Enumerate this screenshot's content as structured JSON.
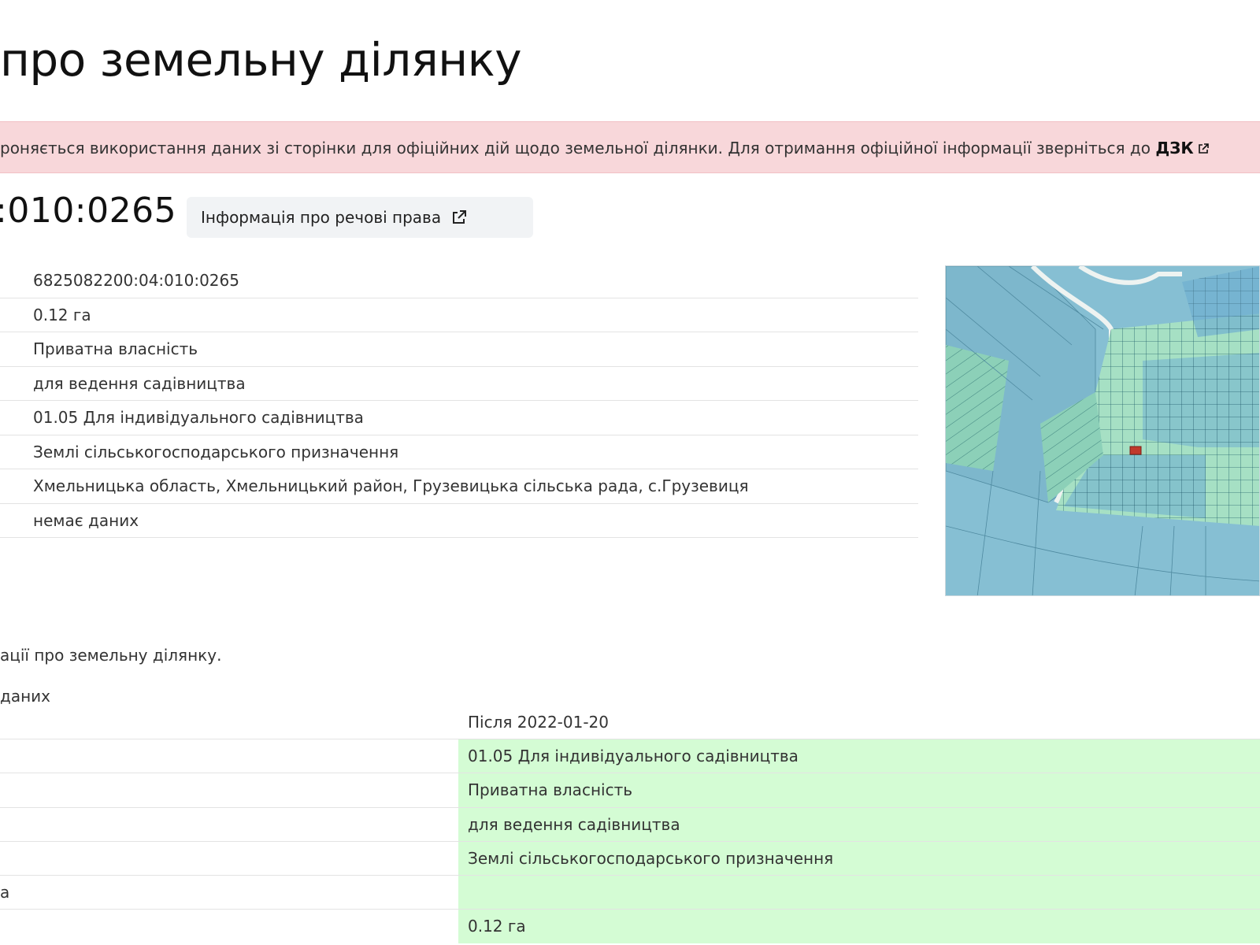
{
  "header": {
    "title": "про земельну ділянку"
  },
  "warning": {
    "text": "роняється використання даних зі сторінки для офіційних дій щодо земельної ділянки. Для отримання офіційної інформації зверніться до ",
    "link_label": "ДЗК",
    "link_icon": "external-link-icon"
  },
  "parcel": {
    "number": ":010:0265",
    "rights_button_label": "Інформація про речові права",
    "rights_button_icon": "external-link-icon"
  },
  "info_rows": [
    "6825082200:04:010:0265",
    "0.12 га",
    "Приватна власність",
    "для ведення садівництва",
    "01.05 Для індивідуального садівництва",
    "Землі сільськогосподарського призначення",
    "Хмельницька область, Хмельницький район, Грузевицька сільська рада, с.Грузевиця",
    "немає даних"
  ],
  "map": {
    "description_icon": "cadastral-map-thumbnail",
    "highlight_color": "#c0392b"
  },
  "history": {
    "note": "ації про земельну ділянку.",
    "subnote": "даних",
    "column_after": "Після 2022-01-20",
    "rows": [
      {
        "label": "",
        "after": "01.05 Для індивідуального садівництва"
      },
      {
        "label": "",
        "after": "Приватна власність"
      },
      {
        "label": "",
        "after": "для ведення садівництва"
      },
      {
        "label": "",
        "after": "Землі сільськогосподарського призначення"
      },
      {
        "label": "а",
        "after": ""
      },
      {
        "label": "",
        "after": "0.12 га"
      }
    ],
    "changed_color": "#d4fcd4"
  }
}
